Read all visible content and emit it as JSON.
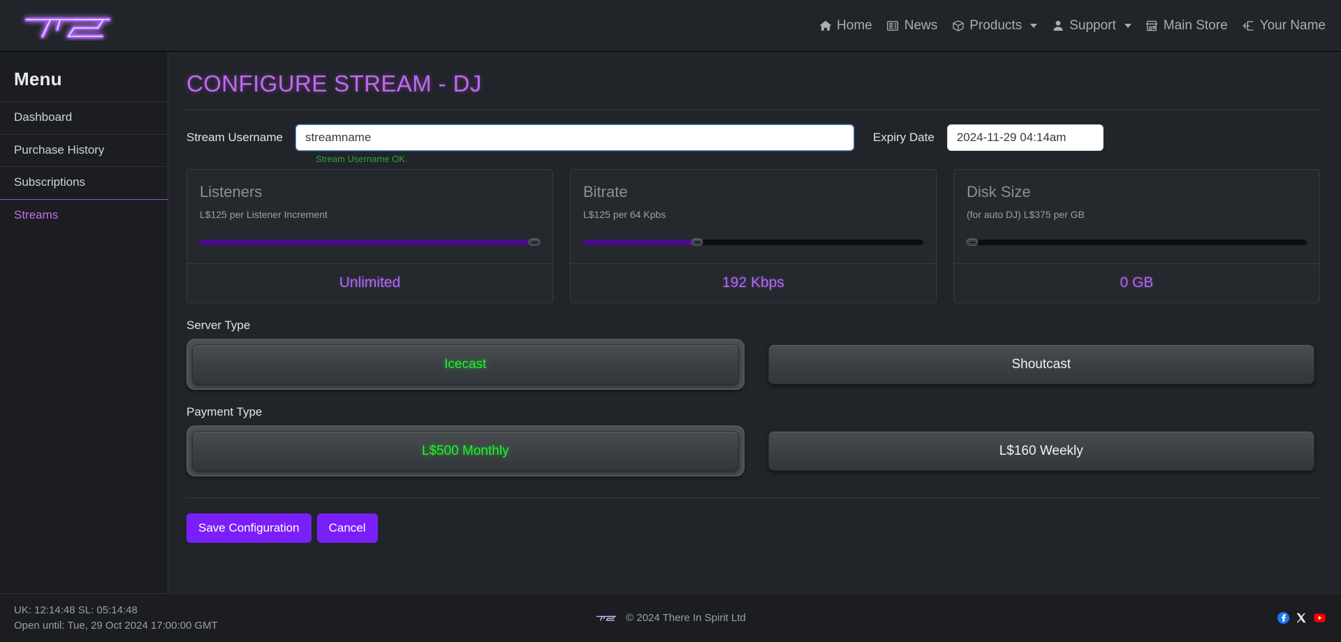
{
  "nav": {
    "brand_logo": "tis-logo",
    "links": [
      {
        "label": "Home",
        "icon": "home-icon",
        "caret": false
      },
      {
        "label": "News",
        "icon": "newspaper-icon",
        "caret": false
      },
      {
        "label": "Products",
        "icon": "box-icon",
        "caret": true
      },
      {
        "label": "Support",
        "icon": "person-icon",
        "caret": true
      },
      {
        "label": "Main Store",
        "icon": "shop-icon",
        "caret": false
      },
      {
        "label": "Your Name",
        "icon": "logout-icon",
        "caret": false
      }
    ]
  },
  "sidebar": {
    "title": "Menu",
    "items": [
      {
        "label": "Dashboard",
        "active": false
      },
      {
        "label": "Purchase History",
        "active": false
      },
      {
        "label": "Subscriptions",
        "active": false
      },
      {
        "label": "Streams",
        "active": true
      }
    ]
  },
  "main": {
    "page_title": "CONFIGURE STREAM - DJ",
    "username_label": "Stream Username",
    "username_value": "streamname",
    "username_placeholder": "streamname",
    "username_validation": "Stream Username OK.",
    "expiry_label": "Expiry Date",
    "expiry_value": "2024-11-29 04:14am",
    "cards": [
      {
        "title": "Listeners",
        "subtitle": "L$125 per Listener Increment",
        "value": "Unlimited",
        "fill_percent": 100
      },
      {
        "title": "Bitrate",
        "subtitle": "L$125 per 64 Kpbs",
        "value": "192 Kbps",
        "fill_percent": 33
      },
      {
        "title": "Disk Size",
        "subtitle": "(for auto DJ) L$375 per GB",
        "value": "0 GB",
        "fill_percent": 0
      }
    ],
    "server_type": {
      "label": "Server Type",
      "options": [
        {
          "label": "Icecast",
          "selected": true
        },
        {
          "label": "Shoutcast",
          "selected": false
        }
      ]
    },
    "payment_type": {
      "label": "Payment Type",
      "options": [
        {
          "label": "L$500 Monthly",
          "selected": true
        },
        {
          "label": "L$160 Weekly",
          "selected": false
        }
      ]
    },
    "actions": {
      "save_label": "Save Configuration",
      "cancel_label": "Cancel"
    }
  },
  "footer": {
    "clock_line": "UK: 12:14:48 SL: 05:14:48",
    "open_line": "Open until: Tue, 29 Oct 2024 17:00:00 GMT",
    "copyright": "© 2024 There In Spirit Ltd",
    "social": [
      {
        "name": "facebook-icon"
      },
      {
        "name": "x-twitter-icon"
      },
      {
        "name": "youtube-icon"
      }
    ]
  },
  "colors": {
    "accent_purple": "#7b1ffa",
    "title_purple": "#c267f0",
    "value_purple": "#b06bf5",
    "selected_green": "#20f32a",
    "valid_green": "#2fa33a",
    "slider_fill": "#4c0b8f"
  }
}
